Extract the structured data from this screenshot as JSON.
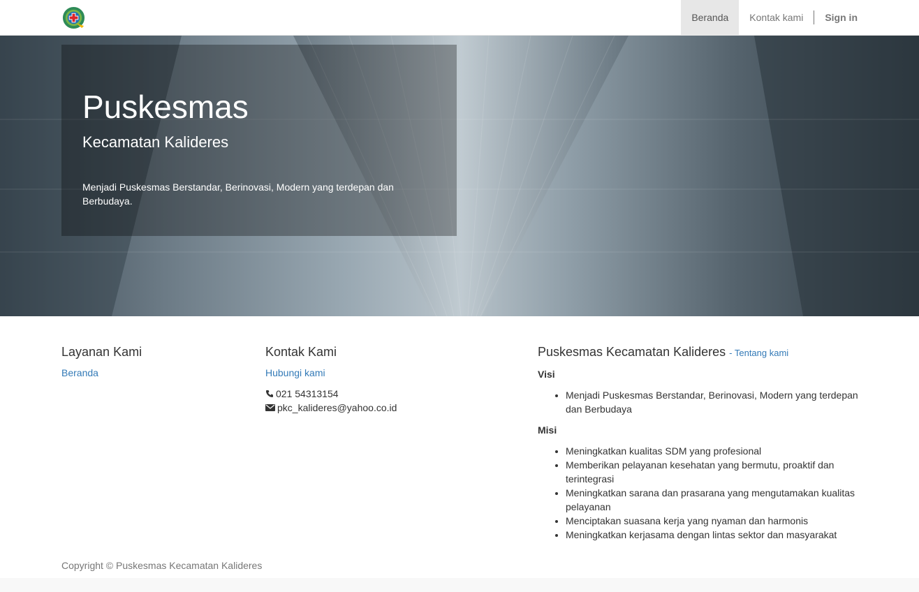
{
  "nav": {
    "logo_alt": "Puskesmas logo",
    "items": [
      "Beranda",
      "Kontak kami"
    ],
    "signin": "Sign in"
  },
  "hero": {
    "title": "Puskesmas",
    "subtitle": "Kecamatan Kalideres",
    "text": "Menjadi Puskesmas Berstandar, Berinovasi, Modern yang terdepan dan Berbudaya."
  },
  "layanan": {
    "heading": "Layanan Kami",
    "links": [
      "Beranda"
    ]
  },
  "kontak": {
    "heading": "Kontak Kami",
    "link": "Hubungi kami",
    "phone": "021 54313154",
    "email": "pkc_kalideres@yahoo.co.id"
  },
  "about": {
    "heading": "Puskesmas Kecamatan Kalideres",
    "link": "- Tentang kami",
    "visi_label": "Visi",
    "visi": [
      "Menjadi Puskesmas Berstandar, Berinovasi, Modern yang terdepan dan Berbudaya"
    ],
    "misi_label": "Misi",
    "misi": [
      "Meningkatkan kualitas SDM yang profesional",
      "Memberikan pelayanan kesehatan yang bermutu, proaktif dan terintegrasi",
      "Meningkatkan sarana dan prasarana yang mengutamakan kualitas pelayanan",
      "Menciptakan suasana kerja yang nyaman dan harmonis",
      "Meningkatkan kerjasama dengan lintas sektor dan masyarakat"
    ]
  },
  "footer": {
    "copyright": "Copyright © Puskesmas Kecamatan Kalideres"
  }
}
